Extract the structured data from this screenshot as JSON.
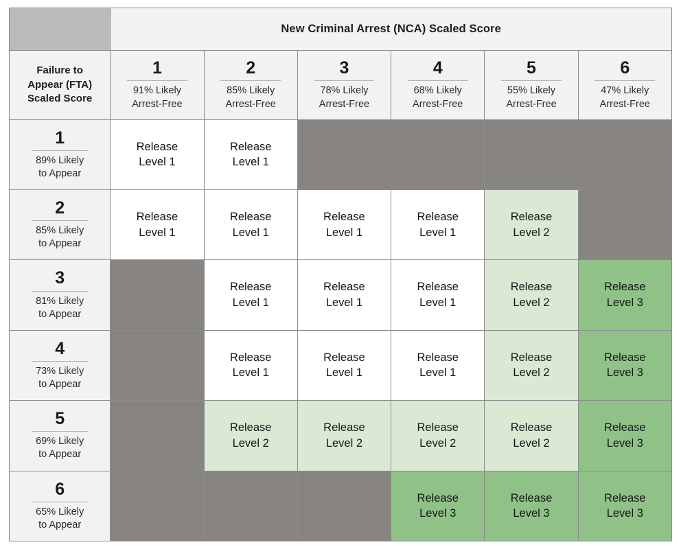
{
  "table": {
    "column_axis_title": "New Criminal Arrest (NCA) Scaled Score",
    "row_axis_title": "Failure to Appear (FTA) Scaled Score",
    "column_headers": [
      {
        "score": "1",
        "sub": "91% Likely Arrest-Free"
      },
      {
        "score": "2",
        "sub": "85% Likely Arrest-Free"
      },
      {
        "score": "3",
        "sub": "78% Likely Arrest-Free"
      },
      {
        "score": "4",
        "sub": "68% Likely Arrest-Free"
      },
      {
        "score": "5",
        "sub": "55% Likely Arrest-Free"
      },
      {
        "score": "6",
        "sub": "47% Likely Arrest-Free"
      }
    ],
    "row_headers": [
      {
        "score": "1",
        "sub": "89% Likely to Appear"
      },
      {
        "score": "2",
        "sub": "85% Likely to Appear"
      },
      {
        "score": "3",
        "sub": "81% Likely to Appear"
      },
      {
        "score": "4",
        "sub": "73% Likely to Appear"
      },
      {
        "score": "5",
        "sub": "69% Likely to Appear"
      },
      {
        "score": "6",
        "sub": "65% Likely to Appear"
      }
    ],
    "cells": [
      [
        {
          "label": "Release Level 1",
          "level": "1"
        },
        {
          "label": "Release Level 1",
          "level": "1"
        },
        {
          "label": "",
          "level": "blocked"
        },
        {
          "label": "",
          "level": "blocked"
        },
        {
          "label": "",
          "level": "blocked"
        },
        {
          "label": "",
          "level": "blocked"
        }
      ],
      [
        {
          "label": "Release Level 1",
          "level": "1"
        },
        {
          "label": "Release Level 1",
          "level": "1"
        },
        {
          "label": "Release Level 1",
          "level": "1"
        },
        {
          "label": "Release Level 1",
          "level": "1"
        },
        {
          "label": "Release Level 2",
          "level": "2"
        },
        {
          "label": "",
          "level": "blocked"
        }
      ],
      [
        {
          "label": "",
          "level": "blocked"
        },
        {
          "label": "Release Level 1",
          "level": "1"
        },
        {
          "label": "Release Level 1",
          "level": "1"
        },
        {
          "label": "Release Level 1",
          "level": "1"
        },
        {
          "label": "Release Level 2",
          "level": "2"
        },
        {
          "label": "Release Level 3",
          "level": "3"
        }
      ],
      [
        {
          "label": "",
          "level": "blocked"
        },
        {
          "label": "Release Level 1",
          "level": "1"
        },
        {
          "label": "Release Level 1",
          "level": "1"
        },
        {
          "label": "Release Level 1",
          "level": "1"
        },
        {
          "label": "Release Level 2",
          "level": "2"
        },
        {
          "label": "Release Level 3",
          "level": "3"
        }
      ],
      [
        {
          "label": "",
          "level": "blocked"
        },
        {
          "label": "Release Level 2",
          "level": "2"
        },
        {
          "label": "Release Level 2",
          "level": "2"
        },
        {
          "label": "Release Level 2",
          "level": "2"
        },
        {
          "label": "Release Level 2",
          "level": "2"
        },
        {
          "label": "Release Level 3",
          "level": "3"
        }
      ],
      [
        {
          "label": "",
          "level": "blocked"
        },
        {
          "label": "",
          "level": "blocked"
        },
        {
          "label": "",
          "level": "blocked"
        },
        {
          "label": "Release Level 3",
          "level": "3"
        },
        {
          "label": "Release Level 3",
          "level": "3"
        },
        {
          "label": "Release Level 3",
          "level": "3"
        }
      ]
    ]
  },
  "colors": {
    "level_1": "#ffffff",
    "level_2": "#dbe8d4",
    "level_3": "#90c288",
    "blocked": "#878482",
    "corner": "#bcbaba",
    "header_bg": "#f2f2f2",
    "grid_line": "#8c8c8c"
  }
}
